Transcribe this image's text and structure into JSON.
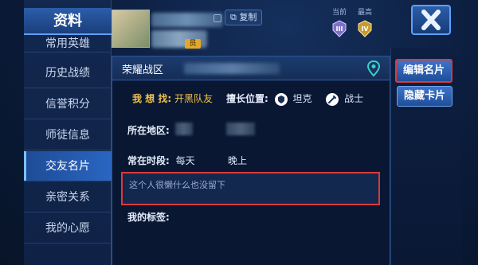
{
  "sidebar": {
    "title": "资料",
    "items": [
      {
        "label": "常用英雄"
      },
      {
        "label": "历史战绩"
      },
      {
        "label": "信誉积分"
      },
      {
        "label": "师徒信息"
      },
      {
        "label": "交友名片"
      },
      {
        "label": "亲密关系"
      },
      {
        "label": "我的心愿"
      }
    ]
  },
  "header": {
    "vip_text": "员",
    "copy_label": "复制",
    "rank_current_label": "当前",
    "rank_max_label": "最高",
    "rank_current_numeral": "III",
    "rank_max_numeral": "IV"
  },
  "card": {
    "title": "荣耀战区",
    "want_label": "我 想 找:",
    "want_value": "开黑队友",
    "position_label": "擅长位置:",
    "role1": "坦克",
    "role2": "战士",
    "region_label": "所在地区:",
    "period_label": "常在时段:",
    "period_day": "每天",
    "period_time": "晚上",
    "signature_placeholder": "这个人很懒什么也没留下",
    "tags_label": "我的标签:"
  },
  "actions": {
    "edit_label": "编辑名片",
    "hide_label": "隐藏卡片"
  },
  "colors": {
    "accent": "#2a66c2",
    "highlight_border": "#d93a3a",
    "want_text": "#f0c24a"
  }
}
